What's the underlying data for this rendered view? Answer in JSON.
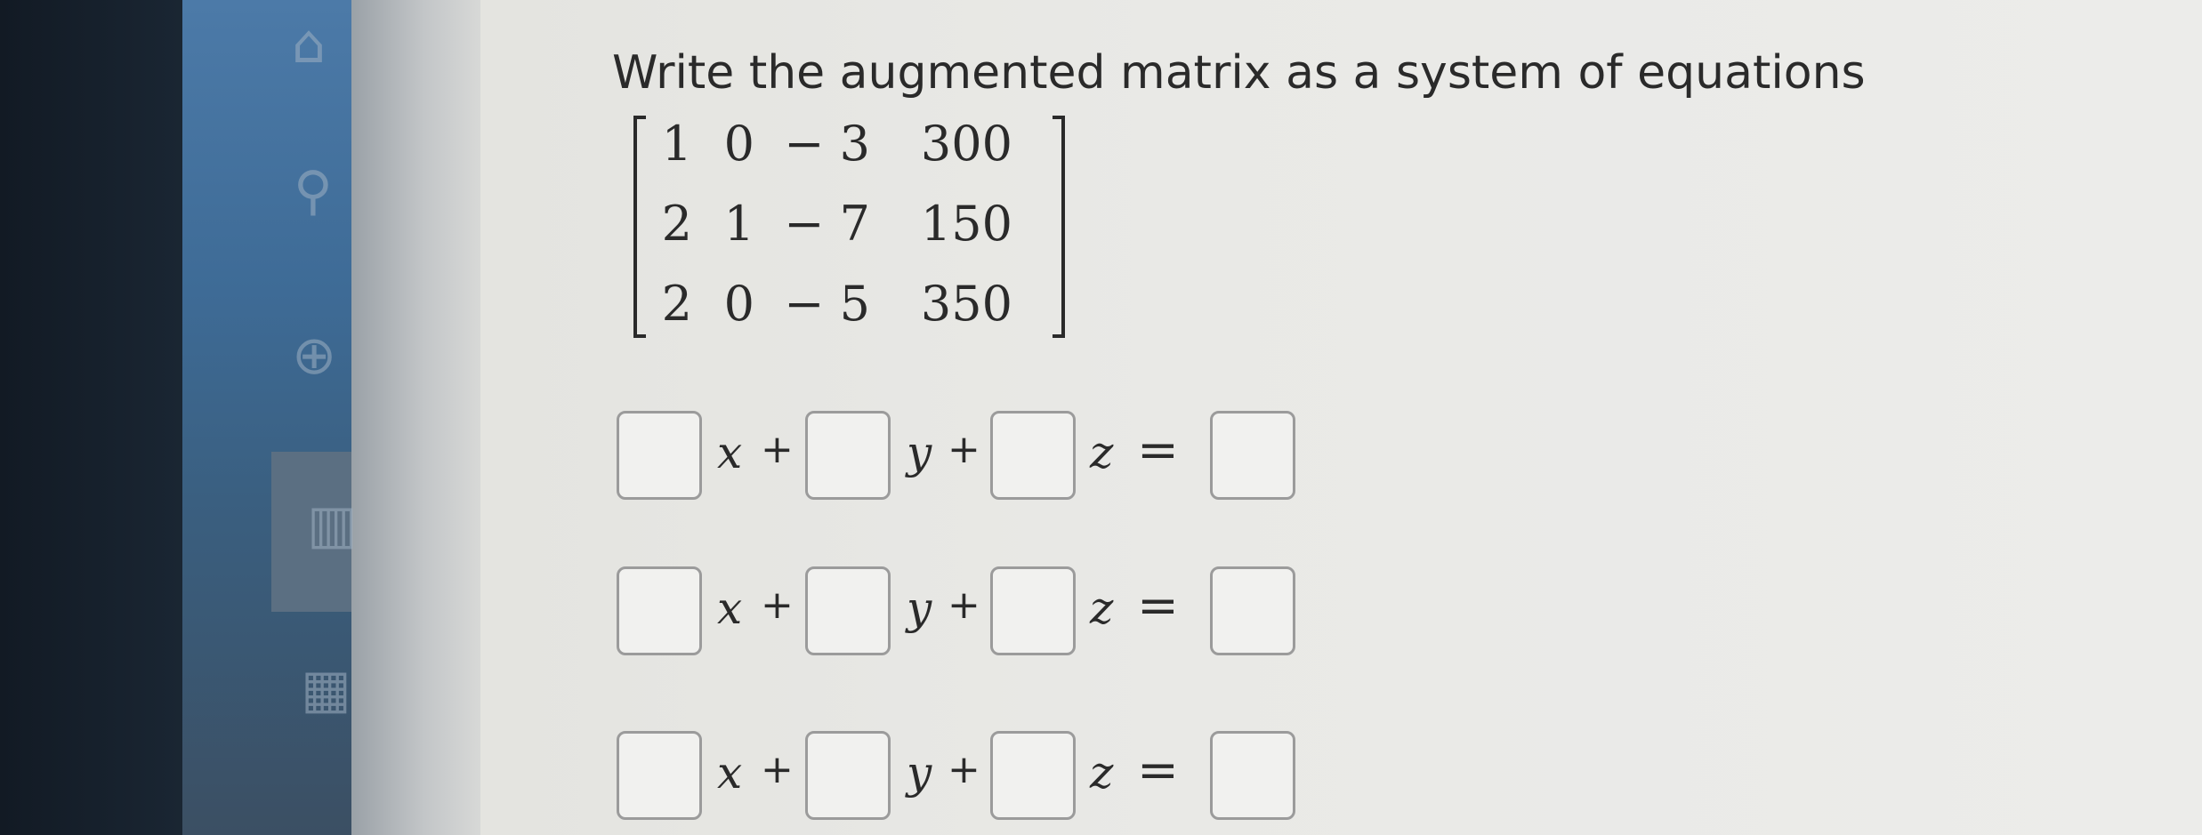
{
  "question": {
    "title": "Write the augmented matrix as a system of equations"
  },
  "matrix": {
    "rows": [
      [
        "1",
        "0",
        "− 3",
        "300"
      ],
      [
        "2",
        "1",
        "− 7",
        "150"
      ],
      [
        "2",
        "0",
        "− 5",
        "350"
      ]
    ]
  },
  "equations": [
    {
      "x_label": "x",
      "y_label": "y",
      "z_label": "z",
      "plus1": "+",
      "plus2": "+",
      "equals": "=",
      "x_coef": "",
      "y_coef": "",
      "z_coef": "",
      "rhs": ""
    },
    {
      "x_label": "x",
      "y_label": "y",
      "z_label": "z",
      "plus1": "+",
      "plus2": "+",
      "equals": "=",
      "x_coef": "",
      "y_coef": "",
      "z_coef": "",
      "rhs": ""
    },
    {
      "x_label": "x",
      "y_label": "y",
      "z_label": "z",
      "plus1": "+",
      "plus2": "+",
      "equals": "=",
      "x_coef": "",
      "y_coef": "",
      "z_coef": "",
      "rhs": ""
    }
  ],
  "sidebar": {
    "icons": [
      "bank-icon",
      "search-icon",
      "globe-icon",
      "book-icon",
      "calculator-icon"
    ]
  }
}
